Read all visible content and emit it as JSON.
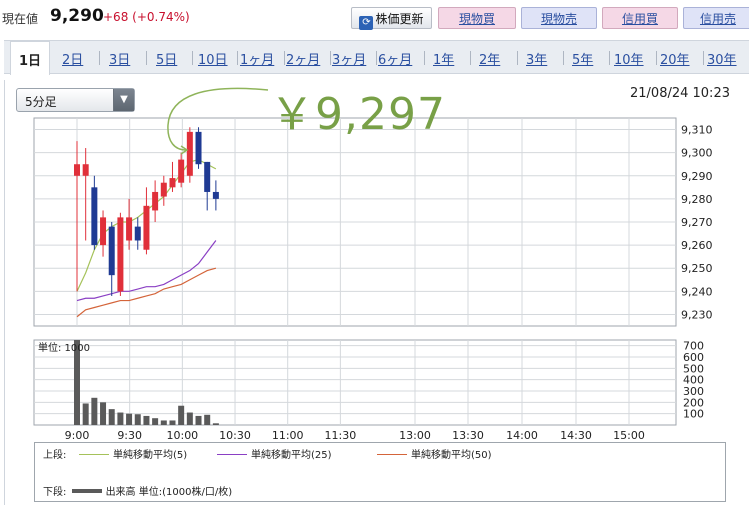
{
  "header": {
    "price_label": "現在値",
    "price_value": "9,290",
    "price_change": "+68 (+0.74%)",
    "refresh_label": "株価更新",
    "trade_buttons": [
      "現物買",
      "現物売",
      "信用買",
      "信用売"
    ]
  },
  "period_tabs": [
    "1日",
    "2日",
    "3日",
    "5日",
    "10日",
    "1ヶ月",
    "2ヶ月",
    "3ヶ月",
    "6ヶ月",
    "1年",
    "2年",
    "3年",
    "5年",
    "10年",
    "20年",
    "30年"
  ],
  "active_tab": "1日",
  "interval_select": {
    "value": "5分足"
  },
  "datetime": "21/08/24 10:23",
  "highlight_price": "￥9,297",
  "colors": {
    "up": "#e0303a",
    "down": "#1f3a93",
    "ma5": "#a5c25a",
    "ma25": "#8a3fc4",
    "ma50": "#d4643a",
    "volume": "#5a5a5a",
    "big_price": "#78a047"
  },
  "chart_data": {
    "type": "candlestick",
    "price_axis": {
      "min": 9225,
      "max": 9315,
      "ticks": [
        9230,
        9240,
        9250,
        9260,
        9270,
        9280,
        9290,
        9300,
        9310
      ],
      "tick_labels": [
        "9,230",
        "9,240",
        "9,250",
        "9,260",
        "9,270",
        "9,280",
        "9,290",
        "9,300",
        "9,310"
      ]
    },
    "x_axis": {
      "labels": [
        "9:00",
        "9:30",
        "10:00",
        "10:30",
        "11:00",
        "11:30",
        "13:00",
        "13:30",
        "14:00",
        "14:30",
        "15:00"
      ]
    },
    "candles": [
      {
        "time": "9:00",
        "open": 9290,
        "high": 9305,
        "low": 9240,
        "close": 9295
      },
      {
        "time": "9:05",
        "open": 9290,
        "high": 9302,
        "low": 9262,
        "close": 9295
      },
      {
        "time": "9:10",
        "open": 9285,
        "high": 9290,
        "low": 9258,
        "close": 9260
      },
      {
        "time": "9:15",
        "open": 9260,
        "high": 9275,
        "low": 9255,
        "close": 9272
      },
      {
        "time": "9:20",
        "open": 9268,
        "high": 9270,
        "low": 9238,
        "close": 9247
      },
      {
        "time": "9:25",
        "open": 9240,
        "high": 9274,
        "low": 9238,
        "close": 9272
      },
      {
        "time": "9:30",
        "open": 9262,
        "high": 9280,
        "low": 9258,
        "close": 9272
      },
      {
        "time": "9:35",
        "open": 9268,
        "high": 9272,
        "low": 9258,
        "close": 9262
      },
      {
        "time": "9:40",
        "open": 9258,
        "high": 9285,
        "low": 9256,
        "close": 9277
      },
      {
        "time": "9:45",
        "open": 9275,
        "high": 9288,
        "low": 9270,
        "close": 9283
      },
      {
        "time": "9:50",
        "open": 9281,
        "high": 9290,
        "low": 9277,
        "close": 9287
      },
      {
        "time": "9:55",
        "open": 9285,
        "high": 9296,
        "low": 9283,
        "close": 9289
      },
      {
        "time": "10:00",
        "open": 9287,
        "high": 9300,
        "low": 9285,
        "close": 9297
      },
      {
        "time": "10:05",
        "open": 9290,
        "high": 9311,
        "low": 9287,
        "close": 9309
      },
      {
        "time": "10:10",
        "open": 9309,
        "high": 9311,
        "low": 9293,
        "close": 9295
      },
      {
        "time": "10:15",
        "open": 9296,
        "high": 9296,
        "low": 9275,
        "close": 9283
      },
      {
        "time": "10:20",
        "open": 9283,
        "high": 9288,
        "low": 9275,
        "close": 9280
      }
    ],
    "ma5": [
      9240,
      9248,
      9258,
      9265,
      9268,
      9270,
      9270,
      9272,
      9275,
      9278,
      9281,
      9286,
      9291,
      9296,
      9297,
      9295,
      9293
    ],
    "ma25": [
      9236,
      9237,
      9237,
      9238,
      9239,
      9240,
      9240,
      9241,
      9242,
      9242,
      9243,
      9245,
      9247,
      9249,
      9252,
      9257,
      9262
    ],
    "ma50": [
      9229,
      9232,
      9233,
      9234,
      9235,
      9236,
      9236,
      9237,
      9238,
      9239,
      9241,
      9242,
      9243,
      9245,
      9247,
      9249,
      9250
    ],
    "volume": {
      "unit_label": "単位: 1000",
      "axis": {
        "min": 0,
        "max": 750,
        "ticks": [
          100,
          200,
          300,
          400,
          500,
          600,
          700
        ]
      },
      "values": [
        750,
        190,
        240,
        200,
        140,
        110,
        100,
        95,
        80,
        60,
        40,
        40,
        170,
        110,
        80,
        90,
        15
      ]
    }
  },
  "legend": {
    "upper_label": "上段:",
    "ma5_label": "単純移動平均(5)",
    "ma25_label": "単純移動平均(25)",
    "ma50_label": "単純移動平均(50)",
    "lower_label": "下段:",
    "volume_label": "出来高 単位:(1000株/口/枚)"
  }
}
